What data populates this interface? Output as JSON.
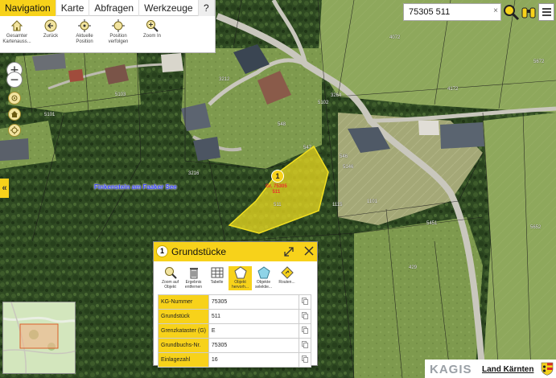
{
  "ribbon": {
    "tabs": [
      {
        "label": "Navigation",
        "active": true
      },
      {
        "label": "Karte",
        "active": false
      },
      {
        "label": "Abfragen",
        "active": false
      },
      {
        "label": "Werkzeuge",
        "active": false
      },
      {
        "label": "?",
        "active": false
      }
    ],
    "tools": [
      {
        "label": "Gesamter Kartenauss...",
        "icon": "home-icon"
      },
      {
        "label": "Zurück",
        "icon": "back-arrow-icon"
      },
      {
        "label": "Aktuelle Position",
        "icon": "crosshair-icon"
      },
      {
        "label": "Position verfolgen",
        "icon": "crosshair-follow-icon"
      },
      {
        "label": "Zoom In",
        "icon": "zoom-in-icon"
      }
    ]
  },
  "map_controls": {
    "zoom_in": "+",
    "zoom_out": "−",
    "collapse": "«"
  },
  "search": {
    "value": "75305 511",
    "clear": "×"
  },
  "map": {
    "place_label": "Finkenstein am Faaker See",
    "parcel_labels": [
      "4072",
      "4172",
      "5672",
      "3212",
      "5103",
      "5101",
      "5102",
      "3264",
      "3216",
      "548",
      "547",
      "546",
      "5146",
      "1115",
      "1101",
      "5451",
      "5652",
      "429",
      "511",
      "5104",
      "5103",
      "4201",
      "429"
    ],
    "marker_number": "1",
    "marker_text": [
      "Gr. 75305",
      "511"
    ]
  },
  "popup": {
    "number": "1",
    "title": "Grundstücke",
    "tools": [
      {
        "label": "Zoom auf Objekt",
        "icon": "zoom-to-object-icon",
        "active": false
      },
      {
        "label": "Ergebnis entfernen",
        "icon": "trash-icon",
        "active": false
      },
      {
        "label": "Tabelle",
        "icon": "table-icon",
        "active": false
      },
      {
        "label": "Objekt hervorh...",
        "icon": "highlight-polygon-icon",
        "active": true
      },
      {
        "label": "Objekte selektie...",
        "icon": "select-polygon-icon",
        "active": false
      },
      {
        "label": "Routen...",
        "icon": "route-icon",
        "active": false
      }
    ],
    "rows": [
      {
        "key": "KG-Nummer",
        "value": "75305"
      },
      {
        "key": "Grundstück",
        "value": "511"
      },
      {
        "key": "Grenzkataster (G)",
        "value": "E"
      },
      {
        "key": "Grundbuchs-Nr.",
        "value": "75305"
      },
      {
        "key": "Einlagezahl",
        "value": "16"
      }
    ]
  },
  "footer": {
    "kagis": "KAGIS",
    "land": "Land Kärnten"
  },
  "colors": {
    "accent": "#f7d21a",
    "parcel_fill": "#f2e020",
    "place_label": "#3b46ff"
  }
}
